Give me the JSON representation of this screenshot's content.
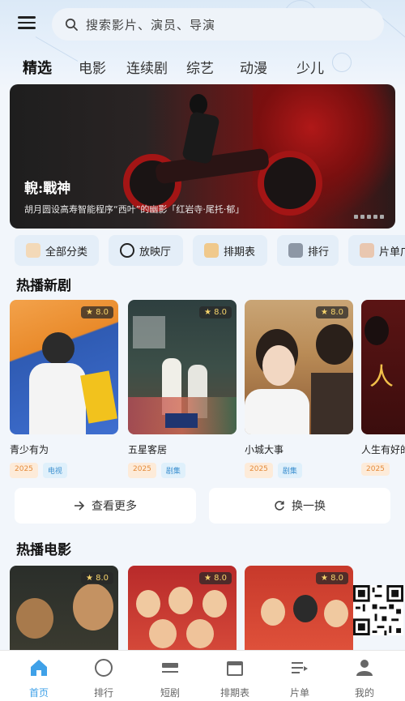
{
  "search": {
    "placeholder": "搜索影片、演员、导演"
  },
  "tabs": [
    {
      "label": "精选",
      "active": true
    },
    {
      "label": "电影",
      "active": false
    },
    {
      "label": "连续剧",
      "active": false
    },
    {
      "label": "综艺",
      "active": false
    },
    {
      "label": "动漫",
      "active": false
    },
    {
      "label": "少儿",
      "active": false
    }
  ],
  "banner": {
    "title": "輗:戰神",
    "subtitle": "胡月圆设高寿智能程序“西叶”的幽影「红岩寺·尾托·郁」",
    "page_indicator": "1/5"
  },
  "quick": [
    {
      "label": "全部分类",
      "icon": "cat-icon"
    },
    {
      "label": "放映厅",
      "icon": "circle-icon"
    },
    {
      "label": "排期表",
      "icon": "cat-icon"
    },
    {
      "label": "排行",
      "icon": "cat-icon"
    },
    {
      "label": "片单广",
      "icon": "cat-icon"
    }
  ],
  "section_drama": {
    "title": "热播新剧",
    "cards": [
      {
        "name": "青少有为",
        "score": "8.0",
        "year": "2025",
        "type": "电视"
      },
      {
        "name": "五星客居",
        "score": "8.0",
        "year": "2025",
        "type": "剧集"
      },
      {
        "name": "小城大事",
        "score": "8.0",
        "year": "2025",
        "type": "剧集"
      },
      {
        "name": "人生有好的",
        "score": "",
        "year": "2025",
        "type": ""
      }
    ],
    "more_label": "查看更多",
    "refresh_label": "换一换"
  },
  "section_movie": {
    "title": "热播电影",
    "cards": [
      {
        "score": "8.0"
      },
      {
        "score": "8.0"
      },
      {
        "score": "8.0"
      }
    ]
  },
  "bottom_nav": [
    {
      "label": "首页",
      "icon": "home-icon",
      "active": true
    },
    {
      "label": "排行",
      "icon": "circle-icon",
      "active": false
    },
    {
      "label": "短剧",
      "icon": "tv-icon",
      "active": false
    },
    {
      "label": "排期表",
      "icon": "calendar-icon",
      "active": false
    },
    {
      "label": "片单",
      "icon": "list-icon",
      "active": false
    },
    {
      "label": "我的",
      "icon": "user-icon",
      "active": false
    }
  ],
  "colors": {
    "accent": "#3fa1e8",
    "tag_year": "#e48b3c",
    "tag_type": "#3c8fcf"
  }
}
